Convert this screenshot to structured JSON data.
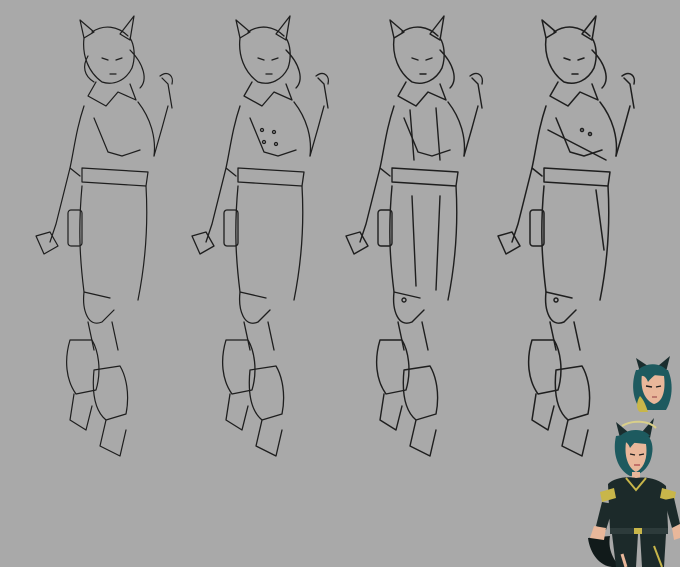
{
  "canvas": {
    "background": "#a9a9a9"
  },
  "sketches": [
    {
      "name": "sketch-pose-1",
      "stage": "lineart"
    },
    {
      "name": "sketch-pose-2",
      "stage": "lineart"
    },
    {
      "name": "sketch-pose-3",
      "stage": "lineart"
    },
    {
      "name": "sketch-pose-4",
      "stage": "lineart"
    }
  ],
  "references": {
    "portrait": {
      "hair_color": "#1d5a5f",
      "accent_color": "#c8b64a"
    },
    "full_body": {
      "hair_color": "#1d5a5f",
      "outfit_color": "#1c2a2a",
      "accent_color": "#c8b64a",
      "skin_color": "#e9b79a"
    }
  },
  "colors": {
    "line": "#1e1e1e",
    "line_light": "#3a3a3a"
  }
}
